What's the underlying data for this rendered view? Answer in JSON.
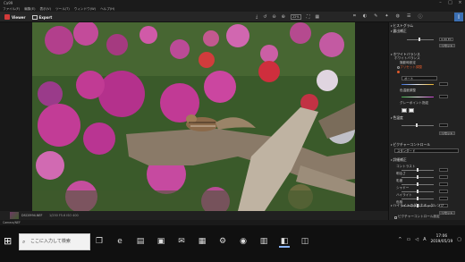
{
  "titlebar": {
    "title": "Ca99"
  },
  "menu": [
    "ファイル(F)",
    "編集(E)",
    "表示(V)",
    "ツール(T)",
    "ウィンドウ(W)",
    "ヘルプ(H)"
  ],
  "toolbar": {
    "viewer_label": "Viewer",
    "export_label": "Export",
    "zoom": "22%",
    "panel_icon": "sidebar-icon"
  },
  "panel": {
    "histogram": "ヒストグラム",
    "exposure_sec": "露出補正",
    "exposure_val": "0.00 EV",
    "reset": "リセット",
    "wb_sec": "ホワイトバランス",
    "wb_sub": "ホワイトバランス",
    "wb_opt1": "撮影時設定",
    "wb_opt2": "プリセット調整",
    "wb_preset": "オート",
    "wb_temp_label": "色温度調整",
    "gray_point": "グレーポイント指定",
    "tone_sec": "色温度",
    "reset2": "リセット",
    "picture_sec": "ピクチャーコントロール",
    "picture_val": "スタンダード",
    "detail_sec": "詳細補正",
    "detail_rows": [
      "コントラスト",
      "明るさ",
      "彩度",
      "シャドー",
      "ハイライト",
      "色相"
    ],
    "reset3": "リセット",
    "bottom_sec": "ハイライトのダイナミックレンジ",
    "bottom_chk": "ピクチャーコントロール設定"
  },
  "filmstrip": {
    "filename": "DSC0994.NEF",
    "meta": "1/250 F5.6 ISO 400"
  },
  "status": "Camera/NEF",
  "taskbar": {
    "search_placeholder": "ここに入力して検索",
    "time": "17:06",
    "date": "2019/05/19"
  }
}
